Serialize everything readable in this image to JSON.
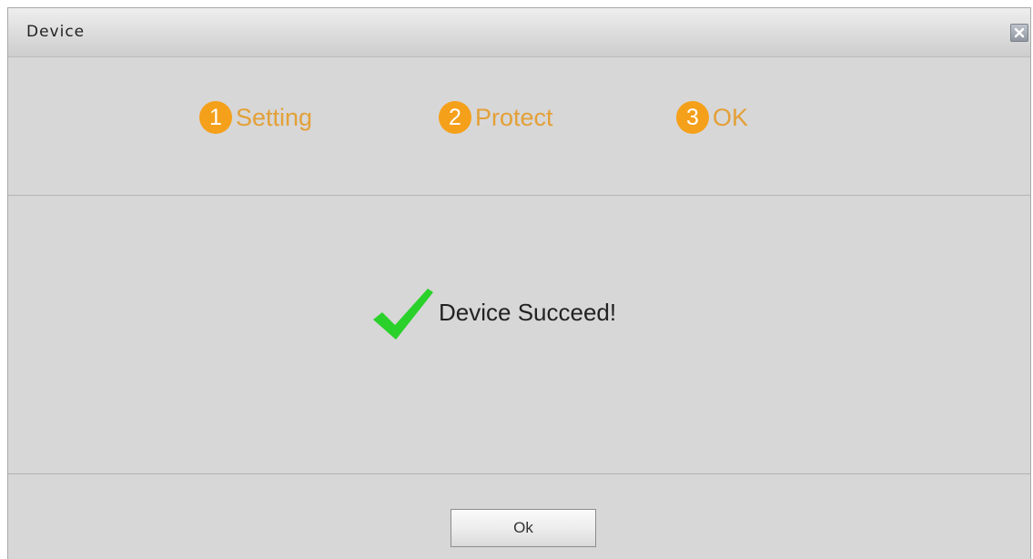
{
  "dialog": {
    "title": "Device",
    "close_icon": "close-icon"
  },
  "steps": [
    {
      "number": "1",
      "label": "Setting"
    },
    {
      "number": "2",
      "label": "Protect"
    },
    {
      "number": "3",
      "label": "OK"
    }
  ],
  "result": {
    "icon": "checkmark-icon",
    "message": "Device Succeed!"
  },
  "footer": {
    "ok_label": "Ok"
  },
  "colors": {
    "step_circle": "#f5a01a",
    "step_label": "#e3a037",
    "checkmark": "#2bd12b",
    "dialog_bg": "#d7d7d7"
  }
}
